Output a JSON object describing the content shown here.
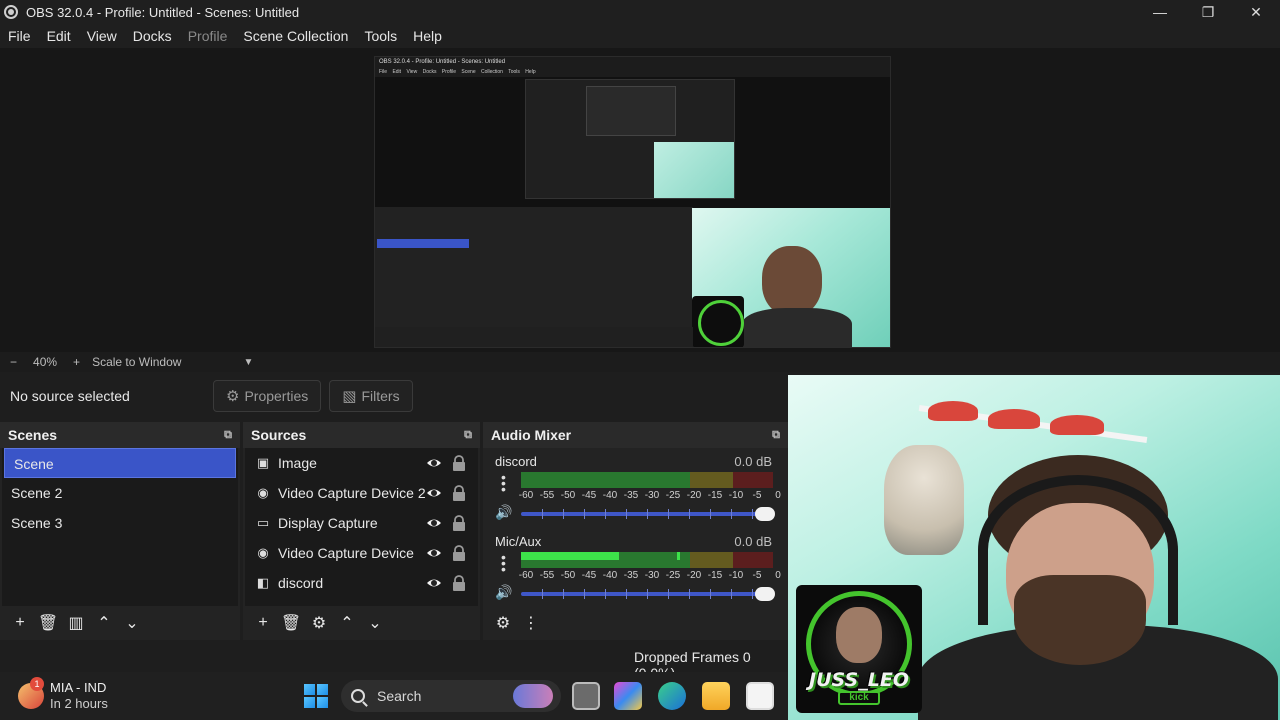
{
  "window": {
    "title": "OBS 32.0.4 - Profile: Untitled - Scenes: Untitled",
    "controls": {
      "minimize": "—",
      "maximize": "❐",
      "close": "✕"
    }
  },
  "menu": {
    "items": [
      {
        "label": "File",
        "enabled": true
      },
      {
        "label": "Edit",
        "enabled": true
      },
      {
        "label": "View",
        "enabled": true
      },
      {
        "label": "Docks",
        "enabled": true
      },
      {
        "label": "Profile",
        "enabled": false
      },
      {
        "label": "Scene Collection",
        "enabled": true
      },
      {
        "label": "Tools",
        "enabled": true
      },
      {
        "label": "Help",
        "enabled": true
      }
    ]
  },
  "preview": {
    "nested_title": "OBS 32.0.4 - Profile: Untitled - Scenes: Untitled",
    "nested_menu": "File Edit View Docks Profile Scene Collection Tools Help"
  },
  "zoom": {
    "minus": "−",
    "level": "40%",
    "plus": "+",
    "mode": "Scale to Window"
  },
  "context": {
    "no_source": "No source selected",
    "properties_label": "Properties",
    "filters_label": "Filters"
  },
  "scenes": {
    "header": "Scenes",
    "items": [
      "Scene",
      "Scene 2",
      "Scene 3"
    ],
    "selected_index": 0
  },
  "sources": {
    "header": "Sources",
    "items": [
      {
        "name": "Image",
        "icon": "image-icon"
      },
      {
        "name": "Video Capture Device 2",
        "icon": "camera-icon"
      },
      {
        "name": "Display Capture",
        "icon": "monitor-icon"
      },
      {
        "name": "Video Capture Device",
        "icon": "camera-icon"
      },
      {
        "name": "discord",
        "icon": "speaker-icon"
      }
    ]
  },
  "mixer": {
    "header": "Audio Mixer",
    "ticks": [
      "-60",
      "-55",
      "-50",
      "-45",
      "-40",
      "-35",
      "-30",
      "-25",
      "-20",
      "-15",
      "-10",
      "-5",
      "0"
    ],
    "channels": [
      {
        "name": "discord",
        "db": "0.0 dB",
        "level_fraction": 0.0,
        "volume_fraction": 1.0
      },
      {
        "name": "Mic/Aux",
        "db": "0.0 dB",
        "level_fraction": 0.62,
        "volume_fraction": 1.0
      }
    ]
  },
  "status": {
    "dropped_frames": "Dropped Frames 0 (0.0%)"
  },
  "overlay": {
    "logo_name": "JUSS_LEO",
    "logo_tag": "kick"
  },
  "taskbar": {
    "weather_line1": "MIA - IND",
    "weather_line2": "In 2 hours",
    "badge_count": "1",
    "search_label": "Search"
  },
  "colors": {
    "accent": "#3a55c8",
    "meter_green": "#2fbf3b",
    "meter_yellow": "#9b8a1e",
    "meter_red": "#8c1b1b"
  }
}
